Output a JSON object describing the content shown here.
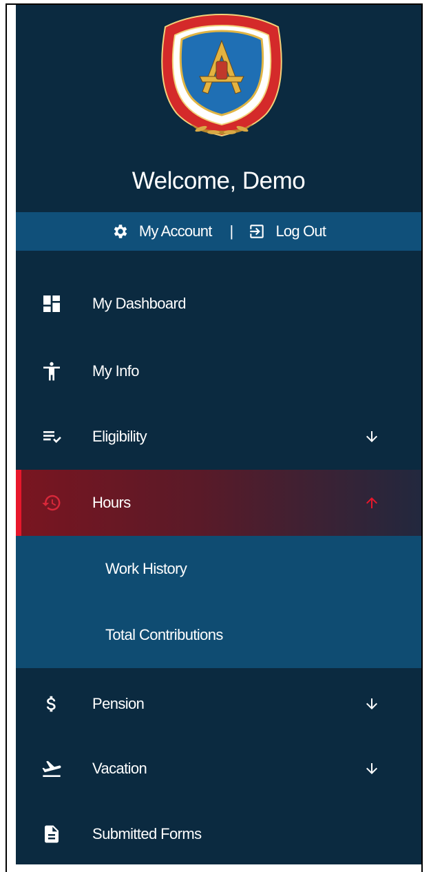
{
  "header": {
    "logo_text": "UNITED BROTHERHOOD OF CARPENTERS AND JOINERS OF AMERICA",
    "logo_motto": "LABOR OMNIA VINCIT",
    "welcome": "Welcome, Demo"
  },
  "account_bar": {
    "my_account": "My Account",
    "separator": "|",
    "log_out": "Log Out"
  },
  "nav": {
    "items": [
      {
        "label": "My Dashboard",
        "icon": "dashboard-icon"
      },
      {
        "label": "My Info",
        "icon": "person-icon"
      },
      {
        "label": "Eligibility",
        "icon": "checklist-icon",
        "arrow": "down"
      },
      {
        "label": "Hours",
        "icon": "history-icon",
        "arrow": "up",
        "active": true
      },
      {
        "label": "Pension",
        "icon": "dollar-icon",
        "arrow": "down"
      },
      {
        "label": "Vacation",
        "icon": "flight-takeoff-icon",
        "arrow": "down"
      },
      {
        "label": "Submitted Forms",
        "icon": "document-icon"
      }
    ],
    "hours_submenu": [
      {
        "label": "Work History"
      },
      {
        "label": "Total Contributions"
      }
    ]
  },
  "colors": {
    "sidebar_bg": "#0b2a40",
    "account_bar_bg": "#10507a",
    "submenu_bg": "#0f4c72",
    "active_accent": "#e8172b"
  }
}
